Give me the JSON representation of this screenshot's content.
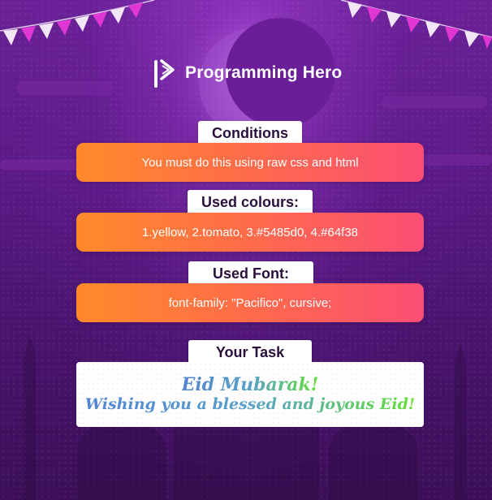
{
  "brand": {
    "name": "Programming Hero",
    "logo_icon": "play-p-icon"
  },
  "sections": [
    {
      "heading": "Conditions",
      "text": "You must do this using raw css and html"
    },
    {
      "heading": "Used colours:",
      "text": "1.yellow, 2.tomato, 3.#5485d0, 4.#64f38"
    },
    {
      "heading": "Used Font:",
      "text": "font-family: \"Pacifico\", cursive;"
    }
  ],
  "task": {
    "heading": "Your Task",
    "line1": "Eid Mubarak!",
    "line2": "Wishing you a blessed and joyous Eid!"
  },
  "colors": {
    "background": "#5b1a86",
    "bar_start": "#ff8a2a",
    "bar_end": "#fb4e74",
    "text_blue": "#5485d0",
    "text_green": "#64f38"
  }
}
